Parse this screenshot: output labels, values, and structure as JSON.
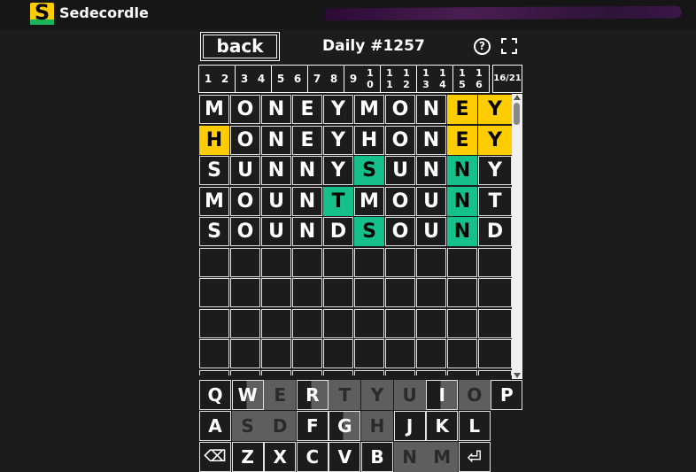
{
  "app": {
    "brand": "Sedecordle",
    "logo_letter": "S"
  },
  "header": {
    "back_label": "back",
    "title": "Daily #1257",
    "help_icon": "?"
  },
  "tabs": [
    [
      "1",
      "2"
    ],
    [
      "3",
      "4"
    ],
    [
      "5",
      "6"
    ],
    [
      "7",
      "8"
    ],
    [
      "9",
      "10"
    ],
    [
      "11",
      "12"
    ],
    [
      "13",
      "14"
    ],
    [
      "15",
      "16"
    ]
  ],
  "solved_count": "16/21",
  "rows": [
    [
      "M",
      "O",
      "N",
      "E",
      "Y",
      "M",
      "O",
      "N",
      "E",
      "Y"
    ],
    [
      "H",
      "O",
      "N",
      "E",
      "Y",
      "H",
      "O",
      "N",
      "E",
      "Y"
    ],
    [
      "S",
      "U",
      "N",
      "N",
      "Y",
      "S",
      "U",
      "N",
      "N",
      "Y"
    ],
    [
      "M",
      "O",
      "U",
      "N",
      "T",
      "M",
      "O",
      "U",
      "N",
      "T"
    ],
    [
      "S",
      "O",
      "U",
      "N",
      "D",
      "S",
      "O",
      "U",
      "N",
      "D"
    ]
  ],
  "colors": {
    "yellow": "#ffcc00",
    "green": "#15c08a",
    "used": "#5e5e5e"
  },
  "keyboard": {
    "row1": [
      "Q",
      "W",
      "E",
      "R",
      "T",
      "Y",
      "U",
      "I",
      "O",
      "P"
    ],
    "row2": [
      "A",
      "S",
      "D",
      "F",
      "G",
      "H",
      "J",
      "K",
      "L"
    ],
    "row3": [
      "⌫",
      "Z",
      "X",
      "C",
      "V",
      "B",
      "N",
      "M",
      "⏎"
    ]
  }
}
